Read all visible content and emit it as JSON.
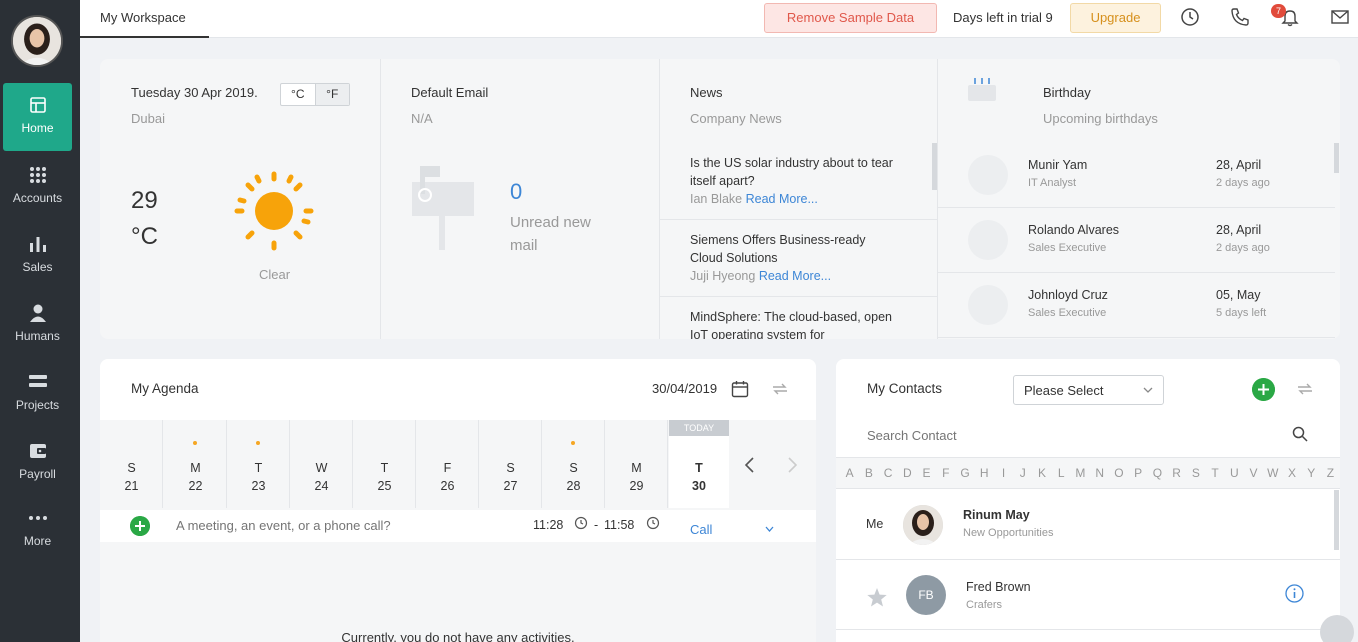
{
  "sidebar": {
    "items": [
      {
        "label": "Home",
        "icon": "home-icon"
      },
      {
        "label": "Accounts",
        "icon": "grid-icon"
      },
      {
        "label": "Sales",
        "icon": "bar-chart-icon"
      },
      {
        "label": "Humans",
        "icon": "user-icon"
      },
      {
        "label": "Projects",
        "icon": "projects-icon"
      },
      {
        "label": "Payroll",
        "icon": "wallet-icon"
      },
      {
        "label": "More",
        "icon": "ellipsis-icon"
      }
    ]
  },
  "topbar": {
    "tab": "My Workspace",
    "remove_sample": "Remove Sample Data",
    "trial": "Days left in trial 9",
    "upgrade": "Upgrade",
    "notif_count": "7"
  },
  "weather": {
    "date": "Tuesday 30 Apr 2019.",
    "city": "Dubai",
    "unit_c": "°C",
    "unit_f": "°F",
    "temp": "29 °C",
    "condition": "Clear"
  },
  "email": {
    "title": "Default Email",
    "sub": "N/A",
    "unread_count": "0",
    "unread_label": "Unread new mail"
  },
  "news": {
    "title": "News",
    "sub": "Company News",
    "items": [
      {
        "headline": "Is the US solar industry about to tear itself apart?",
        "author": "Ian Blake",
        "more": "Read More..."
      },
      {
        "headline": "Siemens Offers Business-ready Cloud Solutions",
        "author": "Juji Hyeong",
        "more": "Read More..."
      },
      {
        "headline": "MindSphere: The cloud-based, open IoT operating system for",
        "author": "",
        "more": ""
      }
    ]
  },
  "birthday": {
    "title": "Birthday",
    "sub": "Upcoming birthdays",
    "items": [
      {
        "name": "Munir Yam",
        "role": "IT Analyst",
        "date": "28, April",
        "ago": "2 days ago"
      },
      {
        "name": "Rolando Alvares",
        "role": "Sales Executive",
        "date": "28, April",
        "ago": "2 days ago"
      },
      {
        "name": "Johnloyd Cruz",
        "role": "Sales Executive",
        "date": "05, May",
        "ago": "5 days left"
      }
    ]
  },
  "agenda": {
    "title": "My Agenda",
    "date": "30/04/2019",
    "days": [
      {
        "name": "S",
        "num": "21"
      },
      {
        "name": "M",
        "num": "22"
      },
      {
        "name": "T",
        "num": "23"
      },
      {
        "name": "W",
        "num": "24"
      },
      {
        "name": "T",
        "num": "25"
      },
      {
        "name": "F",
        "num": "26"
      },
      {
        "name": "S",
        "num": "27"
      },
      {
        "name": "S",
        "num": "28"
      },
      {
        "name": "M",
        "num": "29"
      },
      {
        "name": "T",
        "num": "30"
      }
    ],
    "today_label": "TODAY",
    "quick_placeholder": "A meeting, an event, or a phone call?",
    "time_start": "11:28",
    "time_sep": "-",
    "time_end": "11:58",
    "type": "Call",
    "empty": "Currently, you do not have any activities."
  },
  "contacts": {
    "title": "My Contacts",
    "select": "Please Select",
    "search_placeholder": "Search Contact",
    "letters": [
      "A",
      "B",
      "C",
      "D",
      "E",
      "F",
      "G",
      "H",
      "I",
      "J",
      "K",
      "L",
      "M",
      "N",
      "O",
      "P",
      "Q",
      "R",
      "S",
      "T",
      "U",
      "V",
      "W",
      "X",
      "Y",
      "Z"
    ],
    "me_label": "Me",
    "me_name": "Rinum May",
    "me_sub": "New Opportunities",
    "c1_initials": "FB",
    "c1_name": "Fred Brown",
    "c1_sub": "Crafers"
  },
  "colors": {
    "sidebar_bg": "#2b3036",
    "active_green": "#1fa88a",
    "link_blue": "#3d86d6",
    "add_green": "#2aa845"
  }
}
